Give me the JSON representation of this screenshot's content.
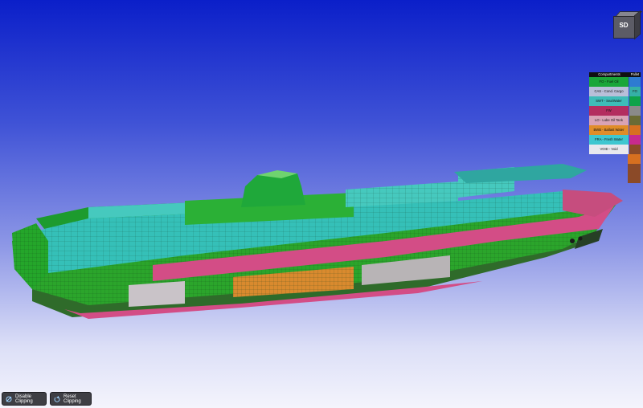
{
  "nav_cube": {
    "label": "SD"
  },
  "legend": {
    "header_compartments": "Compartments",
    "header_pallet": "Pallet",
    "items": [
      {
        "label": "FO - Fuel Oil",
        "color": "#1aa63a",
        "swatch": "#2e7bd1",
        "code": ""
      },
      {
        "label": "CAS - Cond. Cargo",
        "color": "#b9bfd9",
        "swatch": "#35b0a7",
        "code": "FO"
      },
      {
        "label": "SWT - Sea/Water",
        "color": "#3ebcb8",
        "swatch": "#0fa34a",
        "code": ""
      },
      {
        "label": "FW",
        "color": "#b32d5f",
        "swatch": "#8a8a8a",
        "code": ""
      },
      {
        "label": "LO - Lube Oil Tank",
        "color": "#d9a3b5",
        "swatch": "#6b6b35",
        "code": ""
      },
      {
        "label": "BWB - Ballast Water",
        "color": "#e08d2a",
        "swatch": "#d77020",
        "code": ""
      },
      {
        "label": "FRA - Fresh Water",
        "color": "#3fc7d0",
        "swatch": "#c72a8e",
        "code": ""
      },
      {
        "label": "VOID - Void",
        "color": "#e8e8ee",
        "swatch": "#8b4a28",
        "code": ""
      }
    ],
    "extra_palette": [
      "#d77020",
      "#8b4a28",
      "#8b4a28"
    ]
  },
  "toolbar": {
    "disable_clipping": "Disable Clipping",
    "reset_clipping": "Reset Clipping"
  },
  "colors": {
    "hull_green": "#2ba52b",
    "hull_cyan": "#35c0b8",
    "hull_pink": "#d34d86",
    "hull_orange": "#d98a2e"
  }
}
